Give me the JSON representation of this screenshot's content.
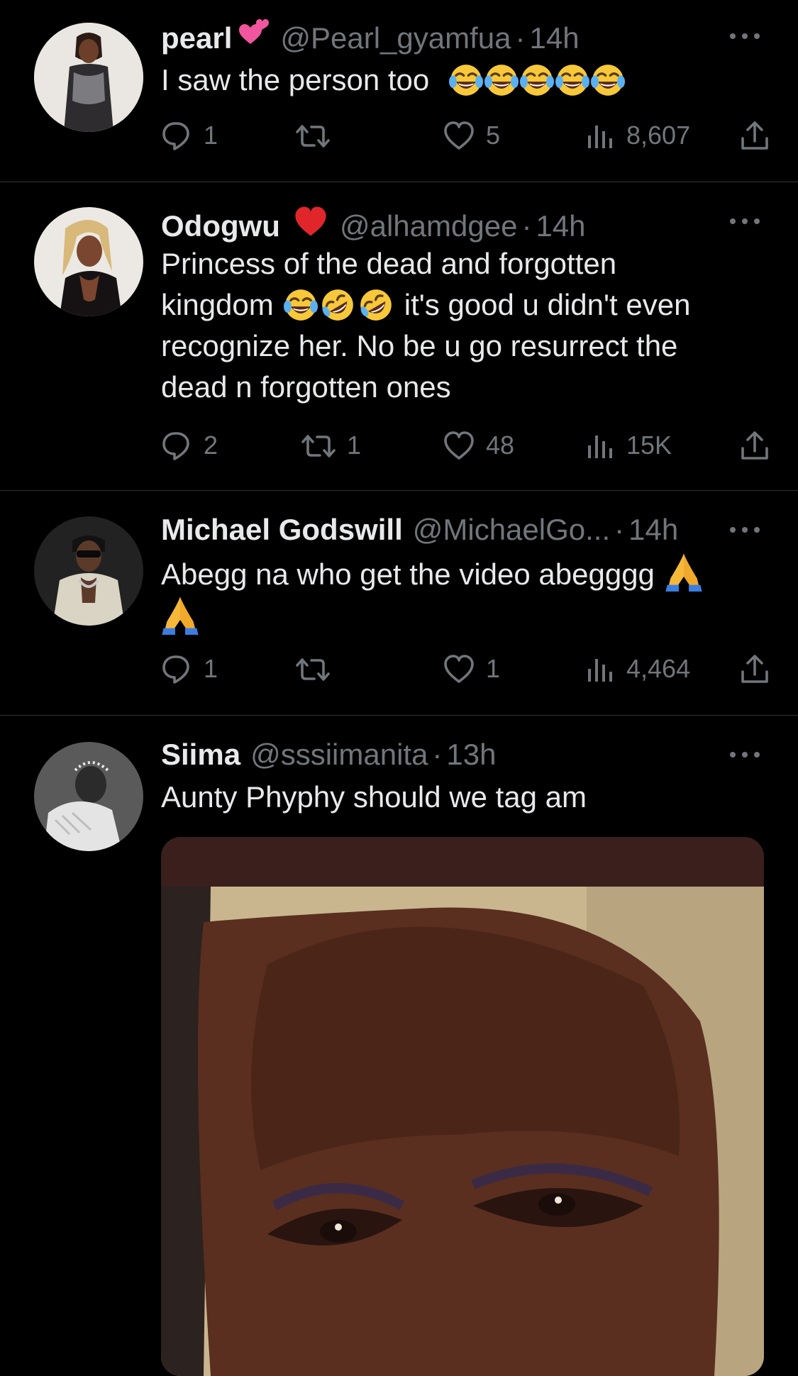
{
  "tweets": [
    {
      "name": "pearl",
      "name_badge_icon": "two-hearts-emoji",
      "handle": "@Pearl_gyamfua",
      "time": "14h",
      "text": "I saw  the person too",
      "text_emojis": [
        "face-with-tears-of-joy",
        "face-with-tears-of-joy",
        "face-with-tears-of-joy",
        "face-with-tears-of-joy",
        "face-with-tears-of-joy"
      ],
      "replies": "1",
      "retweets": "",
      "likes": "5",
      "views": "8,607"
    },
    {
      "name": "Odogwu",
      "name_badge_icon": "red-heart-emoji",
      "handle": "@alhamdgee",
      "time": "14h",
      "text_line1": "Princess of the dead and forgotten",
      "text_line2_pre": "kingdom",
      "text_line2_emojis": [
        "face-with-tears-of-joy",
        "rolling-on-the-floor-laughing",
        "rolling-on-the-floor-laughing"
      ],
      "text_line2_post": "it's good u didn't even",
      "text_line3": "recognize her. No be u go resurrect the",
      "text_line4": "dead n forgotten ones",
      "replies": "2",
      "retweets": "1",
      "likes": "48",
      "views": "15K"
    },
    {
      "name": "Michael Godswill",
      "handle": "@MichaelGo...",
      "time": "14h",
      "text": "Abegg na who get the video abegggg",
      "text_emojis": [
        "folded-hands",
        "folded-hands"
      ],
      "replies": "1",
      "retweets": "",
      "likes": "1",
      "views": "4,464"
    },
    {
      "name": "Siima",
      "handle": "@sssiimanita",
      "time": "13h",
      "text": "Aunty Phyphy should we tag am",
      "media": "photo"
    }
  ],
  "colors": {
    "background": "#000000",
    "primary_text": "#e7e9ea",
    "secondary_text": "#71767b",
    "divider": "#2f3336"
  },
  "icons": {
    "reply": "reply-icon",
    "retweet": "retweet-icon",
    "like": "heart-icon",
    "views": "views-icon",
    "share": "share-icon",
    "more": "more-icon"
  }
}
